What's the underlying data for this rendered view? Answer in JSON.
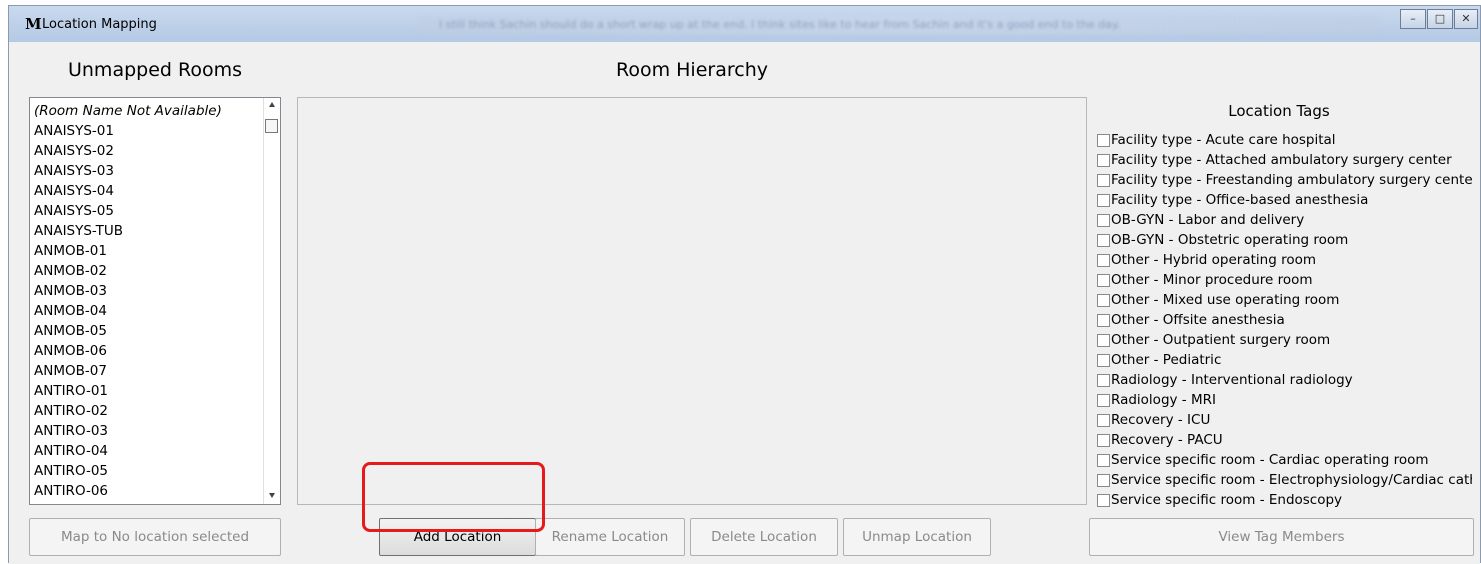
{
  "window": {
    "title": "Location Mapping",
    "icon": "M",
    "blurred_text": "I still think Sachin should do a short wrap up at the end. I think sites like to hear from Sachin and it's a good end to the day.",
    "controls": {
      "minimize": "–",
      "maximize": "□",
      "close": "✕"
    }
  },
  "unmapped": {
    "heading": "Unmapped Rooms",
    "rooms": [
      "(Room Name Not Available)",
      "ANAISYS-01",
      "ANAISYS-02",
      "ANAISYS-03",
      "ANAISYS-04",
      "ANAISYS-05",
      "ANAISYS-TUB",
      "ANMOB-01",
      "ANMOB-02",
      "ANMOB-03",
      "ANMOB-04",
      "ANMOB-05",
      "ANMOB-06",
      "ANMOB-07",
      "ANTIRO-01",
      "ANTIRO-02",
      "ANTIRO-03",
      "ANTIRO-04",
      "ANTIRO-05",
      "ANTIRO-06"
    ],
    "map_button": "Map to No location selected"
  },
  "hierarchy": {
    "heading": "Room Hierarchy",
    "buttons": {
      "add": "Add Location",
      "rename": "Rename Location",
      "delete": "Delete Location",
      "unmap": "Unmap Location"
    }
  },
  "tags": {
    "heading": "Location Tags",
    "items": [
      "Facility type - Acute care hospital",
      "Facility type - Attached ambulatory surgery center",
      "Facility type - Freestanding ambulatory surgery center",
      "Facility type - Office-based anesthesia",
      "OB-GYN - Labor and delivery",
      "OB-GYN - Obstetric operating room",
      "Other - Hybrid operating room",
      "Other - Minor procedure room",
      "Other - Mixed use operating room",
      "Other - Offsite anesthesia",
      "Other - Outpatient surgery room",
      "Other - Pediatric",
      "Radiology - Interventional radiology",
      "Radiology - MRI",
      "Recovery - ICU",
      "Recovery - PACU",
      "Service specific room - Cardiac operating room",
      "Service specific room - Electrophysiology/Cardiac cath",
      "Service specific room - Endoscopy"
    ],
    "view_button": "View Tag Members"
  },
  "colors": {
    "highlight": "#e51b1b",
    "window_bg": "#f0f0f0"
  }
}
